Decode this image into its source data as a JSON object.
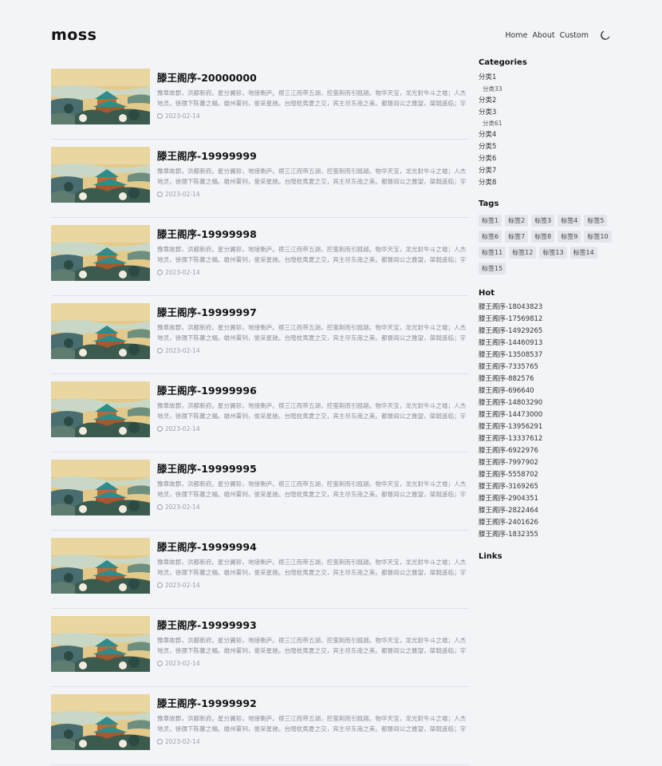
{
  "site": {
    "logo": "moss",
    "nav": [
      "Home",
      "About",
      "Custom"
    ],
    "theme_toggle_icon": "moon-icon"
  },
  "posts": [
    {
      "title": "滕王阁序-20000000",
      "excerpt": "豫章故郡，洪都新府。星分翼轸，地接衡庐。襟三江而带五湖，控蛮荆而引瓯越。物华天宝，龙光射牛斗之墟；人杰地灵，徐孺下陈蕃之榻。雄州雾列，俊采星驰。台隍枕夷夏之交，宾主尽东南之美。都督阎公之雅望，棨戟遥临；宇文新州之懿范，襜帷暂驻。",
      "date": "2023-02-14"
    },
    {
      "title": "滕王阁序-19999999",
      "excerpt": "豫章故郡，洪都新府。星分翼轸，地接衡庐。襟三江而带五湖，控蛮荆而引瓯越。物华天宝，龙光射牛斗之墟；人杰地灵，徐孺下陈蕃之榻。雄州雾列，俊采星驰。台隍枕夷夏之交，宾主尽东南之美。都督阎公之雅望，棨戟遥临；宇文新州之懿范，襜帷暂驻。",
      "date": "2023-02-14"
    },
    {
      "title": "滕王阁序-19999998",
      "excerpt": "豫章故郡，洪都新府。星分翼轸，地接衡庐。襟三江而带五湖，控蛮荆而引瓯越。物华天宝，龙光射牛斗之墟；人杰地灵，徐孺下陈蕃之榻。雄州雾列，俊采星驰。台隍枕夷夏之交，宾主尽东南之美。都督阎公之雅望，棨戟遥临；宇文新州之懿范，襜帷暂驻。",
      "date": "2023-02-14"
    },
    {
      "title": "滕王阁序-19999997",
      "excerpt": "豫章故郡，洪都新府。星分翼轸，地接衡庐。襟三江而带五湖，控蛮荆而引瓯越。物华天宝，龙光射牛斗之墟；人杰地灵，徐孺下陈蕃之榻。雄州雾列，俊采星驰。台隍枕夷夏之交，宾主尽东南之美。都督阎公之雅望，棨戟遥临；宇文新州之懿范，襜帷暂驻。",
      "date": "2023-02-14"
    },
    {
      "title": "滕王阁序-19999996",
      "excerpt": "豫章故郡，洪都新府。星分翼轸，地接衡庐。襟三江而带五湖，控蛮荆而引瓯越。物华天宝，龙光射牛斗之墟；人杰地灵，徐孺下陈蕃之榻。雄州雾列，俊采星驰。台隍枕夷夏之交，宾主尽东南之美。都督阎公之雅望，棨戟遥临；宇文新州之懿范，襜帷暂驻。",
      "date": "2023-02-14"
    },
    {
      "title": "滕王阁序-19999995",
      "excerpt": "豫章故郡，洪都新府。星分翼轸，地接衡庐。襟三江而带五湖，控蛮荆而引瓯越。物华天宝，龙光射牛斗之墟；人杰地灵，徐孺下陈蕃之榻。雄州雾列，俊采星驰。台隍枕夷夏之交，宾主尽东南之美。都督阎公之雅望，棨戟遥临；宇文新州之懿范，襜帷暂驻。",
      "date": "2023-02-14"
    },
    {
      "title": "滕王阁序-19999994",
      "excerpt": "豫章故郡，洪都新府。星分翼轸，地接衡庐。襟三江而带五湖，控蛮荆而引瓯越。物华天宝，龙光射牛斗之墟；人杰地灵，徐孺下陈蕃之榻。雄州雾列，俊采星驰。台隍枕夷夏之交，宾主尽东南之美。都督阎公之雅望，棨戟遥临；宇文新州之懿范，襜帷暂驻。",
      "date": "2023-02-14"
    },
    {
      "title": "滕王阁序-19999993",
      "excerpt": "豫章故郡，洪都新府。星分翼轸，地接衡庐。襟三江而带五湖，控蛮荆而引瓯越。物华天宝，龙光射牛斗之墟；人杰地灵，徐孺下陈蕃之榻。雄州雾列，俊采星驰。台隍枕夷夏之交，宾主尽东南之美。都督阎公之雅望，棨戟遥临；宇文新州之懿范，襜帷暂驻。",
      "date": "2023-02-14"
    },
    {
      "title": "滕王阁序-19999992",
      "excerpt": "豫章故郡，洪都新府。星分翼轸，地接衡庐。襟三江而带五湖，控蛮荆而引瓯越。物华天宝，龙光射牛斗之墟；人杰地灵，徐孺下陈蕃之榻。雄州雾列，俊采星驰。台隍枕夷夏之交，宾主尽东南之美。都督阎公之雅望，棨戟遥临；宇文新州之懿范，襜帷暂驻。",
      "date": "2023-02-14"
    }
  ],
  "sidebar": {
    "categories_title": "Categories",
    "categories": [
      {
        "label": "分类1",
        "sub": false
      },
      {
        "label": "分类33",
        "sub": true
      },
      {
        "label": "分类2",
        "sub": false
      },
      {
        "label": "分类3",
        "sub": false
      },
      {
        "label": "分类61",
        "sub": true
      },
      {
        "label": "分类4",
        "sub": false
      },
      {
        "label": "分类5",
        "sub": false
      },
      {
        "label": "分类6",
        "sub": false
      },
      {
        "label": "分类7",
        "sub": false
      },
      {
        "label": "分类8",
        "sub": false
      }
    ],
    "tags_title": "Tags",
    "tags": [
      "标签1",
      "标签2",
      "标签3",
      "标签4",
      "标签5",
      "标签6",
      "标签7",
      "标签8",
      "标签9",
      "标签10",
      "标签11",
      "标签12",
      "标签13",
      "标签14",
      "标签15"
    ],
    "hot_title": "Hot",
    "hot": [
      "滕王阁序-18043823",
      "滕王阁序-17569812",
      "滕王阁序-14929265",
      "滕王阁序-14460913",
      "滕王阁序-13508537",
      "滕王阁序-7335765",
      "滕王阁序-882576",
      "滕王阁序-696640",
      "滕王阁序-14803290",
      "滕王阁序-14473000",
      "滕王阁序-13956291",
      "滕王阁序-13337612",
      "滕王阁序-6922976",
      "滕王阁序-7997902",
      "滕王阁序-5558702",
      "滕王阁序-3169265",
      "滕王阁序-2904351",
      "滕王阁序-2822464",
      "滕王阁序-2401626",
      "滕王阁序-1832355"
    ],
    "links_title": "Links"
  }
}
